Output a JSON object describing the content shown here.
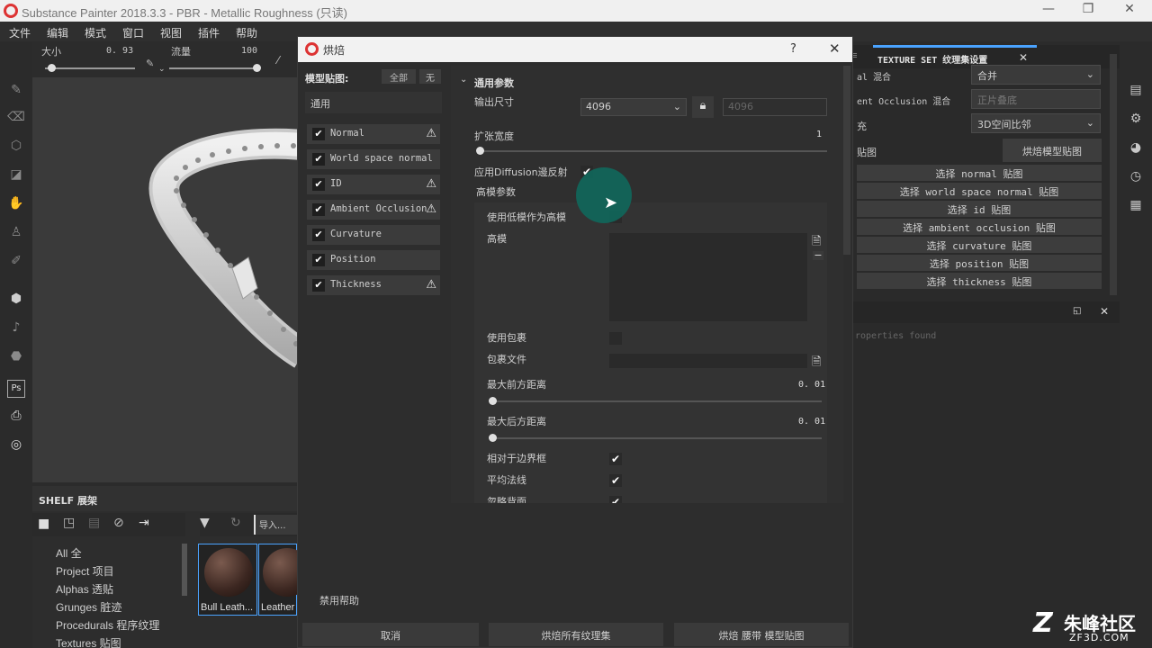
{
  "window": {
    "title": "Substance Painter 2018.3.3 - PBR - Metallic Roughness (只读)",
    "buttons": [
      "—",
      "❐",
      "✕"
    ]
  },
  "menubar": [
    "文件",
    "编辑",
    "模式",
    "窗口",
    "视图",
    "插件",
    "帮助"
  ],
  "tool_options": {
    "size_label": "大小",
    "size_value": "0. 93",
    "size_level": 0.07,
    "flow_label": "流量",
    "flow_value": "100",
    "flow_level": 1.0
  },
  "shelf": {
    "title": "SHELF 展架",
    "categories": [
      "All 全",
      "Project 项目",
      "Alphas 透贴",
      "Grunges 脏迹",
      "Procedurals 程序纹理",
      "Textures 贴图"
    ],
    "search_placeholder": "导入...",
    "items": [
      "Bull Leath...",
      "Leather"
    ]
  },
  "dialog": {
    "title": "烘焙",
    "help": "?",
    "close": "✕",
    "maps_label": "模型贴图:",
    "all_btn": "全部",
    "none_btn": "无",
    "common_label": "通用",
    "maps": [
      {
        "name": "Normal",
        "warn": true
      },
      {
        "name": "World space normal",
        "warn": false
      },
      {
        "name": "ID",
        "warn": true
      },
      {
        "name": "Ambient Occlusion",
        "warn": true
      },
      {
        "name": "Curvature",
        "warn": false
      },
      {
        "name": "Position",
        "warn": false
      },
      {
        "name": "Thickness",
        "warn": true
      }
    ],
    "section_title": "通用参数",
    "output_size_label": "输出尺寸",
    "output_size_value": "4096",
    "output_size_locked": "4096",
    "dilation_label": "扩张宽度",
    "dilation_value": "1",
    "diffusion_label": "应用Diffusion邊反射",
    "highpoly_params": "高模参数",
    "use_lowpoly_label": "使用低模作为高模",
    "highpoly_label": "高模",
    "use_cage_label": "使用包裹",
    "cage_file_label": "包裹文件",
    "max_front_label": "最大前方距离",
    "max_front_value": "0. 01",
    "max_rear_label": "最大后方距离",
    "max_rear_value": "0. 01",
    "relative_bbox_label": "相对于边界框",
    "avg_normals_label": "平均法线",
    "ignore_backface_label": "忽略背面",
    "disable_help": "禁用帮助",
    "cancel": "取消",
    "bake_all": "烘焙所有纹理集",
    "bake_one": "烘焙 腰带 模型贴图"
  },
  "right_panel": {
    "tab_title": "TEXTURE SET 纹理集设置",
    "rows": [
      {
        "label": "al 混合",
        "value": "合并"
      },
      {
        "label": "ent Occlusion 混合",
        "value": "正片叠底"
      },
      {
        "label": "充",
        "value": "3D空间比邻"
      }
    ],
    "bake_row_label": "贴图",
    "bake_button": "烘焙模型贴图",
    "select_buttons": [
      "选择 normal 贴图",
      "选择 world space normal 贴图",
      "选择 id 贴图",
      "选择 ambient occlusion 贴图",
      "选择 curvature 贴图",
      "选择 position 贴图",
      "选择 thickness 贴图"
    ],
    "no_properties": "roperties found"
  },
  "watermark": {
    "brand": "朱峰社区",
    "url": "ZF3D.COM"
  },
  "colors": {
    "accent": "#4aa3ff",
    "cursor_highlight": "#0e6b5e",
    "warning": "#e8e8e8"
  }
}
